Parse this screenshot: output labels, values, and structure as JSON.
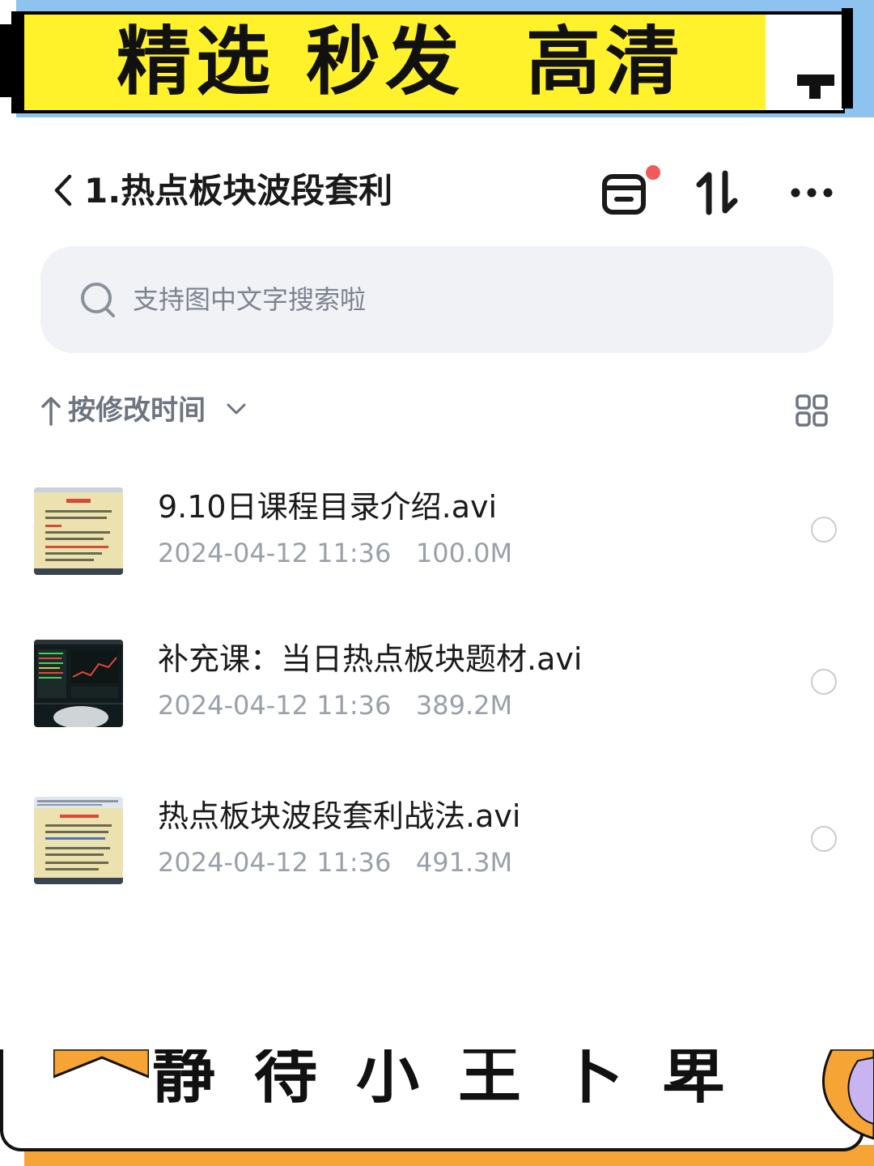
{
  "banner": {
    "text": "精选 秒发  高清"
  },
  "header": {
    "title": "1.热点板块波段套利",
    "badge_color": "#f05a5a"
  },
  "search": {
    "placeholder": "支持图中文字搜索啦"
  },
  "sort": {
    "label": "按修改时间"
  },
  "files": [
    {
      "name": "9.10日课程目录介绍.avi",
      "date": "2024-04-12 11:36",
      "size": "100.0M",
      "thumb": "document"
    },
    {
      "name": "补充课：当日热点板块题材.avi",
      "date": "2024-04-12 11:36",
      "size": "389.2M",
      "thumb": "stock-chart"
    },
    {
      "name": "热点板块波段套利战法.avi",
      "date": "2024-04-12 11:36",
      "size": "491.3M",
      "thumb": "document"
    }
  ],
  "bottom_banner": {
    "text": "静待小王卜卑"
  },
  "icons": [
    "back-icon",
    "box-icon",
    "sort-icon",
    "more-icon",
    "search-icon",
    "grid-icon",
    "chevron-down-icon"
  ]
}
